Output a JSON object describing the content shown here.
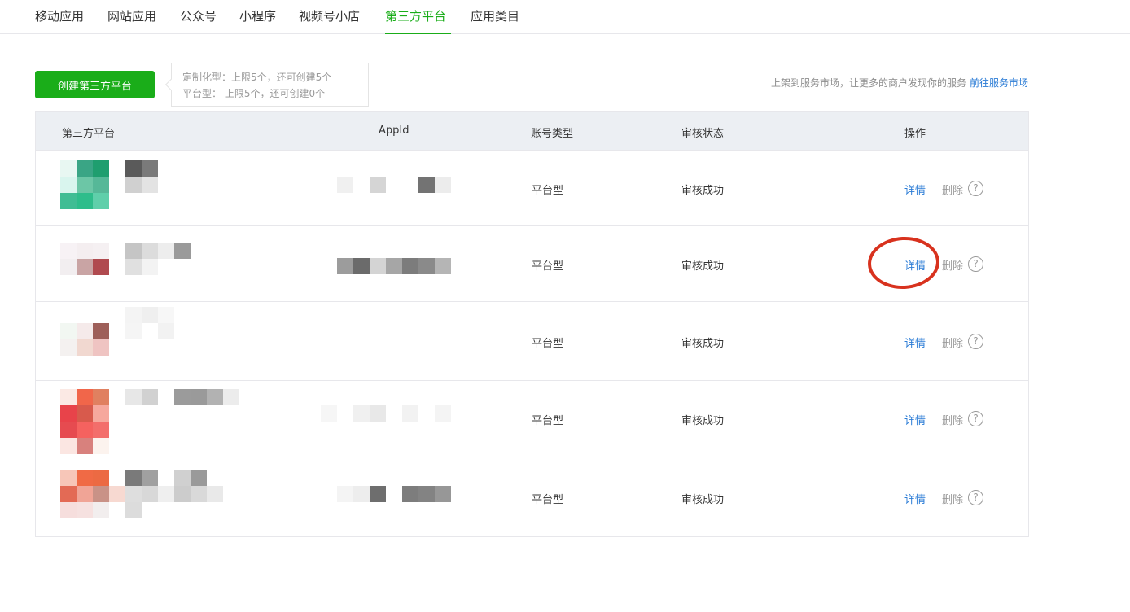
{
  "nav": {
    "tabs": [
      {
        "label": "移动应用"
      },
      {
        "label": "网站应用"
      },
      {
        "label": "公众号"
      },
      {
        "label": "小程序"
      },
      {
        "label": "视频号小店"
      },
      {
        "label": "第三方平台"
      },
      {
        "label": "应用类目"
      }
    ],
    "active_tab": "第三方平台",
    "accent": "#1aad19"
  },
  "toolbar": {
    "create_label": "创建第三方平台",
    "quota_custom": "定制化型：上限5个，还可创建5个",
    "quota_platform": "平台型： 上限5个，还可创建0个",
    "market_text": "上架到服务市场，让更多的商户发现你的服务",
    "market_link": "前往服务市场"
  },
  "table": {
    "headers": {
      "platform": "第三方平台",
      "appid": "AppId",
      "account_type": "账号类型",
      "status": "审核状态",
      "actions": "操作"
    },
    "rows": [
      {
        "type": "平台型",
        "status": "审核成功",
        "detail": "详情",
        "delete": "删除",
        "help": "?"
      },
      {
        "type": "平台型",
        "status": "审核成功",
        "detail": "详情",
        "delete": "删除",
        "help": "?"
      },
      {
        "type": "平台型",
        "status": "审核成功",
        "detail": "详情",
        "delete": "删除",
        "help": "?"
      },
      {
        "type": "平台型",
        "status": "审核成功",
        "detail": "详情",
        "delete": "删除",
        "help": "?"
      },
      {
        "type": "平台型",
        "status": "审核成功",
        "detail": "详情",
        "delete": "删除",
        "help": "?"
      }
    ]
  },
  "colors": {
    "link": "#2b7cd6",
    "annotation_circle": "#d8321e"
  }
}
